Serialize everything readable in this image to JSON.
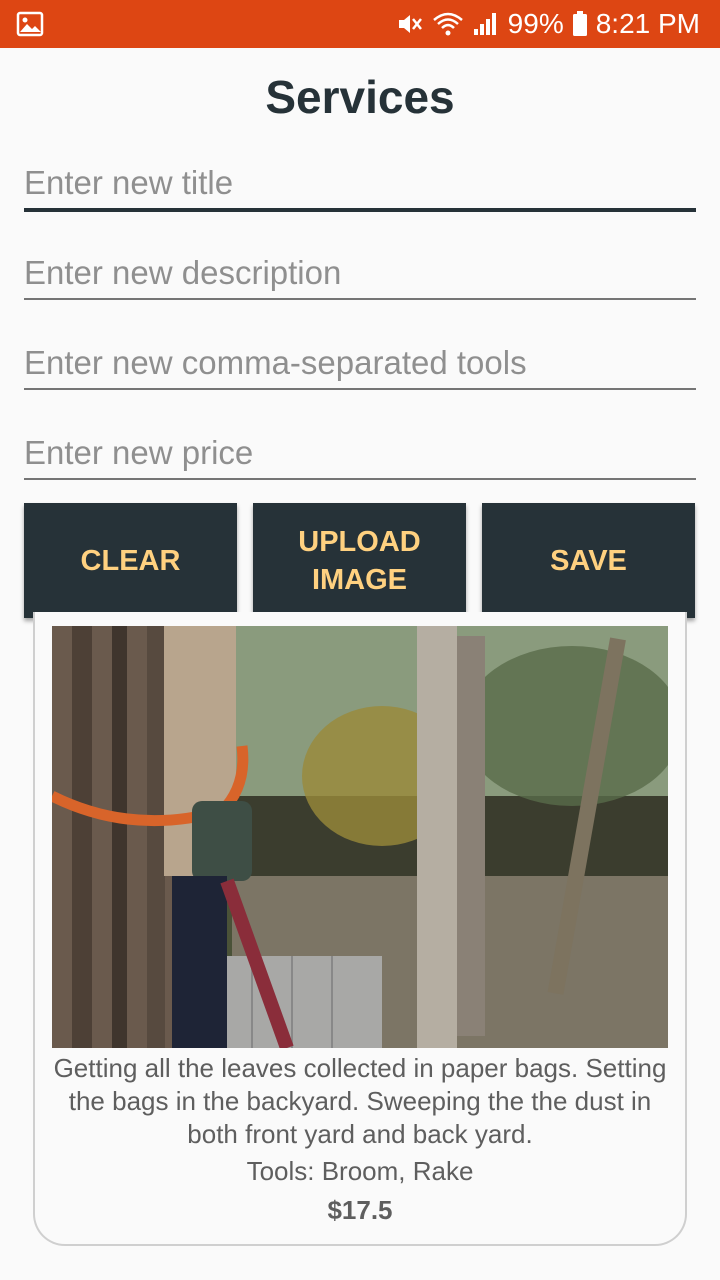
{
  "status_bar": {
    "battery": "99%",
    "time": "8:21 PM",
    "color": "#dd4613",
    "icons": [
      "gallery-icon",
      "mute-icon",
      "wifi-icon",
      "signal-icon",
      "battery-icon"
    ]
  },
  "page": {
    "title": "Services"
  },
  "form": {
    "title": {
      "placeholder": "Enter new title",
      "value": ""
    },
    "description": {
      "placeholder": "Enter new description",
      "value": ""
    },
    "tools": {
      "placeholder": "Enter new comma-separated tools",
      "value": ""
    },
    "price": {
      "placeholder": "Enter new price",
      "value": ""
    }
  },
  "buttons": {
    "clear": "CLEAR",
    "upload": "UPLOAD IMAGE",
    "save": "SAVE"
  },
  "colors": {
    "button_bg": "#263238",
    "button_text": "#ffd180",
    "title_text": "#263238"
  },
  "service_card": {
    "description": "Getting all the leaves collected in paper bags. Setting the bags in the backyard. Sweeping the the dust in both front yard and back yard.",
    "tools": "Tools: Broom, Rake",
    "price": "$17.5"
  }
}
